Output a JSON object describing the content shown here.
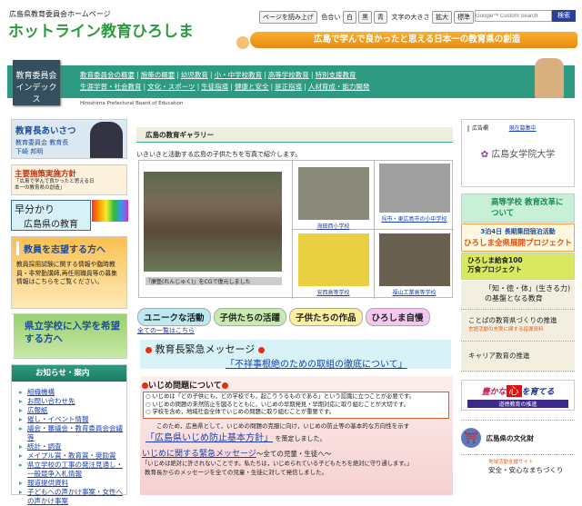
{
  "header": {
    "site_sub": "広島県教育委員会ホームページ",
    "site_title": "ホットライン教育ひろしま",
    "read_aloud": "ページを読み上げ",
    "color_label": "色合い",
    "colors": [
      "白",
      "黒",
      "青"
    ],
    "size_label": "文字の大きさ",
    "size_buttons": [
      "拡大",
      "標準"
    ],
    "search_placeholder": "Google™ Custom Search",
    "search_button": "検索",
    "tagline": "広島で学んで良かったと思える日本一の教育県の創造"
  },
  "nav": {
    "label_line1": "教育委員会",
    "label_line2": "インデックス",
    "row1": [
      "教育委員会の概要",
      "施策の概要",
      "幼児教育",
      "小・中学校教育",
      "高等学校教育",
      "特別支援教育"
    ],
    "row2": [
      "生涯学習・社会教育",
      "文化・スポーツ",
      "生徒指導",
      "健康と安全",
      "是正指導",
      "人材育成・能力開発"
    ],
    "subtitle": "Hiroshima Prefectural Board of Education"
  },
  "left": {
    "greeting": {
      "title": "教育長あいさつ",
      "role": "教育委員会 教育長",
      "name": "下崎 邦明"
    },
    "policy": {
      "title": "主要施策実施方針",
      "desc": "「広島で学んで良かったと思える日本一の教育県の創造」"
    },
    "quick": {
      "line1": "早分かり",
      "line2": "広島県の教育"
    },
    "teacher": {
      "title": "教員を志望する方へ",
      "desc": "教員採用試験に関する情報や臨時教員・非常勤講師,再任用職員等の募集情報はこちらをご覧ください。"
    },
    "admission": {
      "title": "県立学校に入学を希望する方へ"
    },
    "news": {
      "title": "お知らせ・案内",
      "items": [
        "組織機構",
        "お問い合わせ先",
        "広報紙",
        "催し・イベント情報",
        "議会・審議会・教育委員会会議等",
        "統計・調査",
        "メイプル賞・教育賞・奨励賞",
        "県立学校の工事の発注見通し・一般競争入札情報",
        "報道提供資料",
        "子どもへの声かけ事案・女性への声かけ事案"
      ]
    }
  },
  "center": {
    "gallery": {
      "title": "広島の教育ギャラリー",
      "intro": "いきいきと活動する広島の子供たちを写真で紹介します。",
      "main_caption": "「廉塾(れんじゅく)」をCGで復元しました",
      "items": [
        "海田西小学校",
        "呉市・東広島市の小中学校",
        "安西高等学校",
        "福山工業高等学校"
      ]
    },
    "tags": [
      "ユニークな活動",
      "子供たちの活躍",
      "子供たちの作品",
      "ひろしま自慢"
    ],
    "all_list": "全ての一覧はこちら",
    "urgent": {
      "title": "教育長緊急メッセージ",
      "link": "「不祥事根絶のための取組の徹底について」"
    },
    "ijime": {
      "title": "いじめ問題について",
      "points": [
        "○ いじめは「どの子供にも，どの学校でも，起こりうるものである」という認識に立つことが必要です。",
        "○ いじめの問題の未然防止を図るとともに，いじめの早期発見・早期対応に取り組むことが大切です。",
        "○ 学校を含め，地域社会全体でいじめの問題に取り組むことが重要です。"
      ],
      "body": "このため，広島県として，いじめの問題の克服に向け，いじめの防止等の基本的な方向性を示す",
      "policy_link": "「広島県いじめ防止基本方針」",
      "policy_suffix": "を策定しました。",
      "msg_link": "いじめに関する緊急メッセージ",
      "msg_suffix": "～全ての児童・生徒へ～",
      "quote": "「いじめは絶対に許されないことです。私たちは，いじめられている子どもたちを絶対に守り通します。」",
      "note": "教育長からのメッセージを全ての児童・生徒に対して発信しました。"
    }
  },
  "right": {
    "ad": {
      "label": "広告欄",
      "recruit": "現在募集中",
      "sponsor": "広島女学院大学"
    },
    "reform": "高等学校 教育改革について",
    "camp": {
      "line1": "3泊4日 長期集団宿泊活動",
      "line2": "ひろしま全県展開プロジェクト"
    },
    "lunch": "ひろしま給食100万食プロジェクト",
    "ikiru": {
      "line1": "「知・徳・体」(生きる力)",
      "line2": "の基盤となる教育"
    },
    "kotoba": {
      "title": "ことばの教育県づくりの推進",
      "sub": "言語活動の充実に関する指導資料"
    },
    "career": "キャリア教育の推進",
    "kokoro": {
      "pre": "豊かな",
      "heart": "心",
      "post": "を育てる",
      "sub": "道徳教育の推進"
    },
    "bunkazai": "広島県の文化財",
    "chiiki": {
      "sub": "地域活動支援サイト",
      "title": "安全・安心なまちづくり"
    }
  },
  "colors": {
    "teal": "#2e9a82",
    "orange": "#f0a020",
    "green_title": "#2e9a40"
  }
}
